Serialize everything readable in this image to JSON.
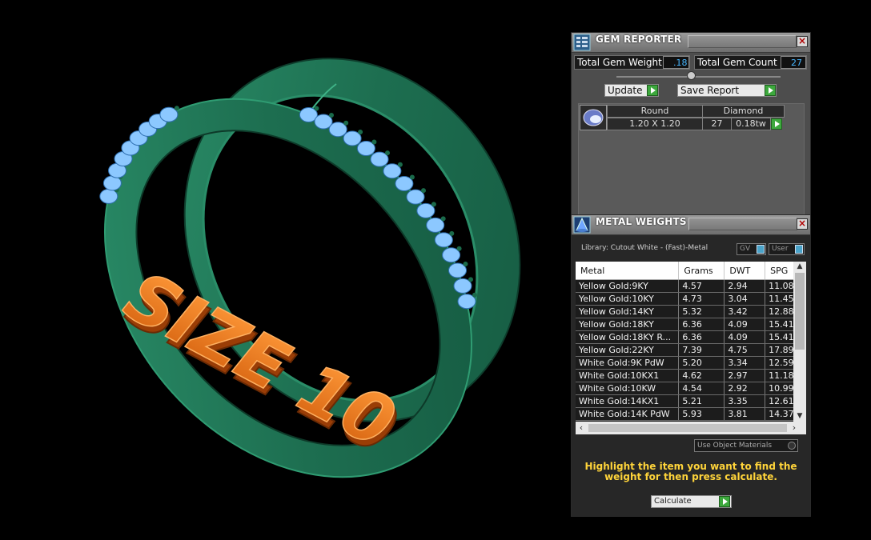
{
  "viewport": {
    "model_text": "SIZE 10",
    "colors": {
      "band": "#1f7a5a",
      "gems": "#8cc8ff",
      "text3d": "#f07a1e",
      "background": "#000000"
    }
  },
  "gem_reporter": {
    "title": "GEM REPORTER",
    "close_icon": "close-icon",
    "total_gem_weight_label": "Total Gem Weight",
    "total_gem_weight_value": ".18",
    "total_gem_count_label": "Total Gem Count",
    "total_gem_count_value": "27",
    "update_label": "Update",
    "save_report_label": "Save Report",
    "gems": [
      {
        "shape": "Round",
        "material": "Diamond",
        "size": "1.20 X 1.20",
        "count": "27",
        "weight": "0.18tw"
      }
    ]
  },
  "metal_weights": {
    "title": "METAL WEIGHTS",
    "library_label": "Library: Cutout White - (Fast)-Metal",
    "toggle_gv": "GV",
    "toggle_user": "User",
    "columns": [
      "Metal",
      "Grams",
      "DWT",
      "SPG"
    ],
    "rows": [
      [
        "Yellow Gold:9KY",
        "4.57",
        "2.94",
        "11.08"
      ],
      [
        "Yellow Gold:10KY",
        "4.73",
        "3.04",
        "11.45"
      ],
      [
        "Yellow Gold:14KY",
        "5.32",
        "3.42",
        "12.88"
      ],
      [
        "Yellow Gold:18KY",
        "6.36",
        "4.09",
        "15.41"
      ],
      [
        "Yellow Gold:18KY R...",
        "6.36",
        "4.09",
        "15.41"
      ],
      [
        "Yellow Gold:22KY",
        "7.39",
        "4.75",
        "17.89"
      ],
      [
        "White Gold:9K PdW",
        "5.20",
        "3.34",
        "12.59"
      ],
      [
        "White Gold:10KX1",
        "4.62",
        "2.97",
        "11.18"
      ],
      [
        "White Gold:10KW",
        "4.54",
        "2.92",
        "10.99"
      ],
      [
        "White Gold:14KX1",
        "5.21",
        "3.35",
        "12.61"
      ],
      [
        "White Gold:14K PdW",
        "5.93",
        "3.81",
        "14.37"
      ]
    ],
    "use_object_materials_label": "Use Object Materials",
    "instruction": "Highlight the item you want to find the weight for then press calculate.",
    "calculate_label": "Calculate"
  }
}
